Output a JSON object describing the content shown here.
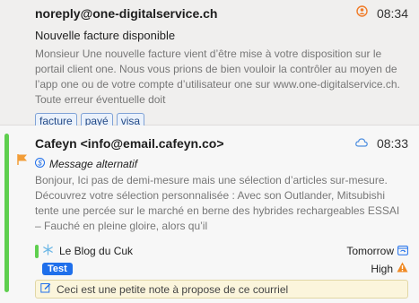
{
  "messages": [
    {
      "sender": "noreply@one-digitalservice.ch",
      "time": "08:34",
      "subject": "Nouvelle facture disponible",
      "preview": "Monsieur Une nouvelle facture vient d’être mise à votre disposition sur le portail client one. Nous vous prions de bien vouloir la contrôler au moyen de l’app one ou de votre compte d’utilisateur one sur www.one-digitalservice.ch. Toute erreur éventuelle doit",
      "tags": [
        "facture",
        "payé",
        "visa"
      ]
    },
    {
      "sender": "Cafeyn <info@email.cafeyn.co>",
      "time": "08:33",
      "alt_label": "Message alternatif",
      "preview": "Bonjour, Ici pas de demi-mesure mais une sélection d’articles sur-mesure. Découvrez votre sélection personnalisée : Avec son Outlander, Mitsubishi tente une percée sur le marché en berne des hybrides rechargeables ESSAI – Fauché en pleine gloire, alors qu’il",
      "project": "Le Blog du Cuk",
      "due": "Tomorrow",
      "tag": "Test",
      "priority": "High",
      "note": "Ceci est une petite note à propose de ce courriel"
    }
  ],
  "colors": {
    "accent": "#1f6feb",
    "green": "#5fcf4f",
    "flag": "#f29d38"
  }
}
